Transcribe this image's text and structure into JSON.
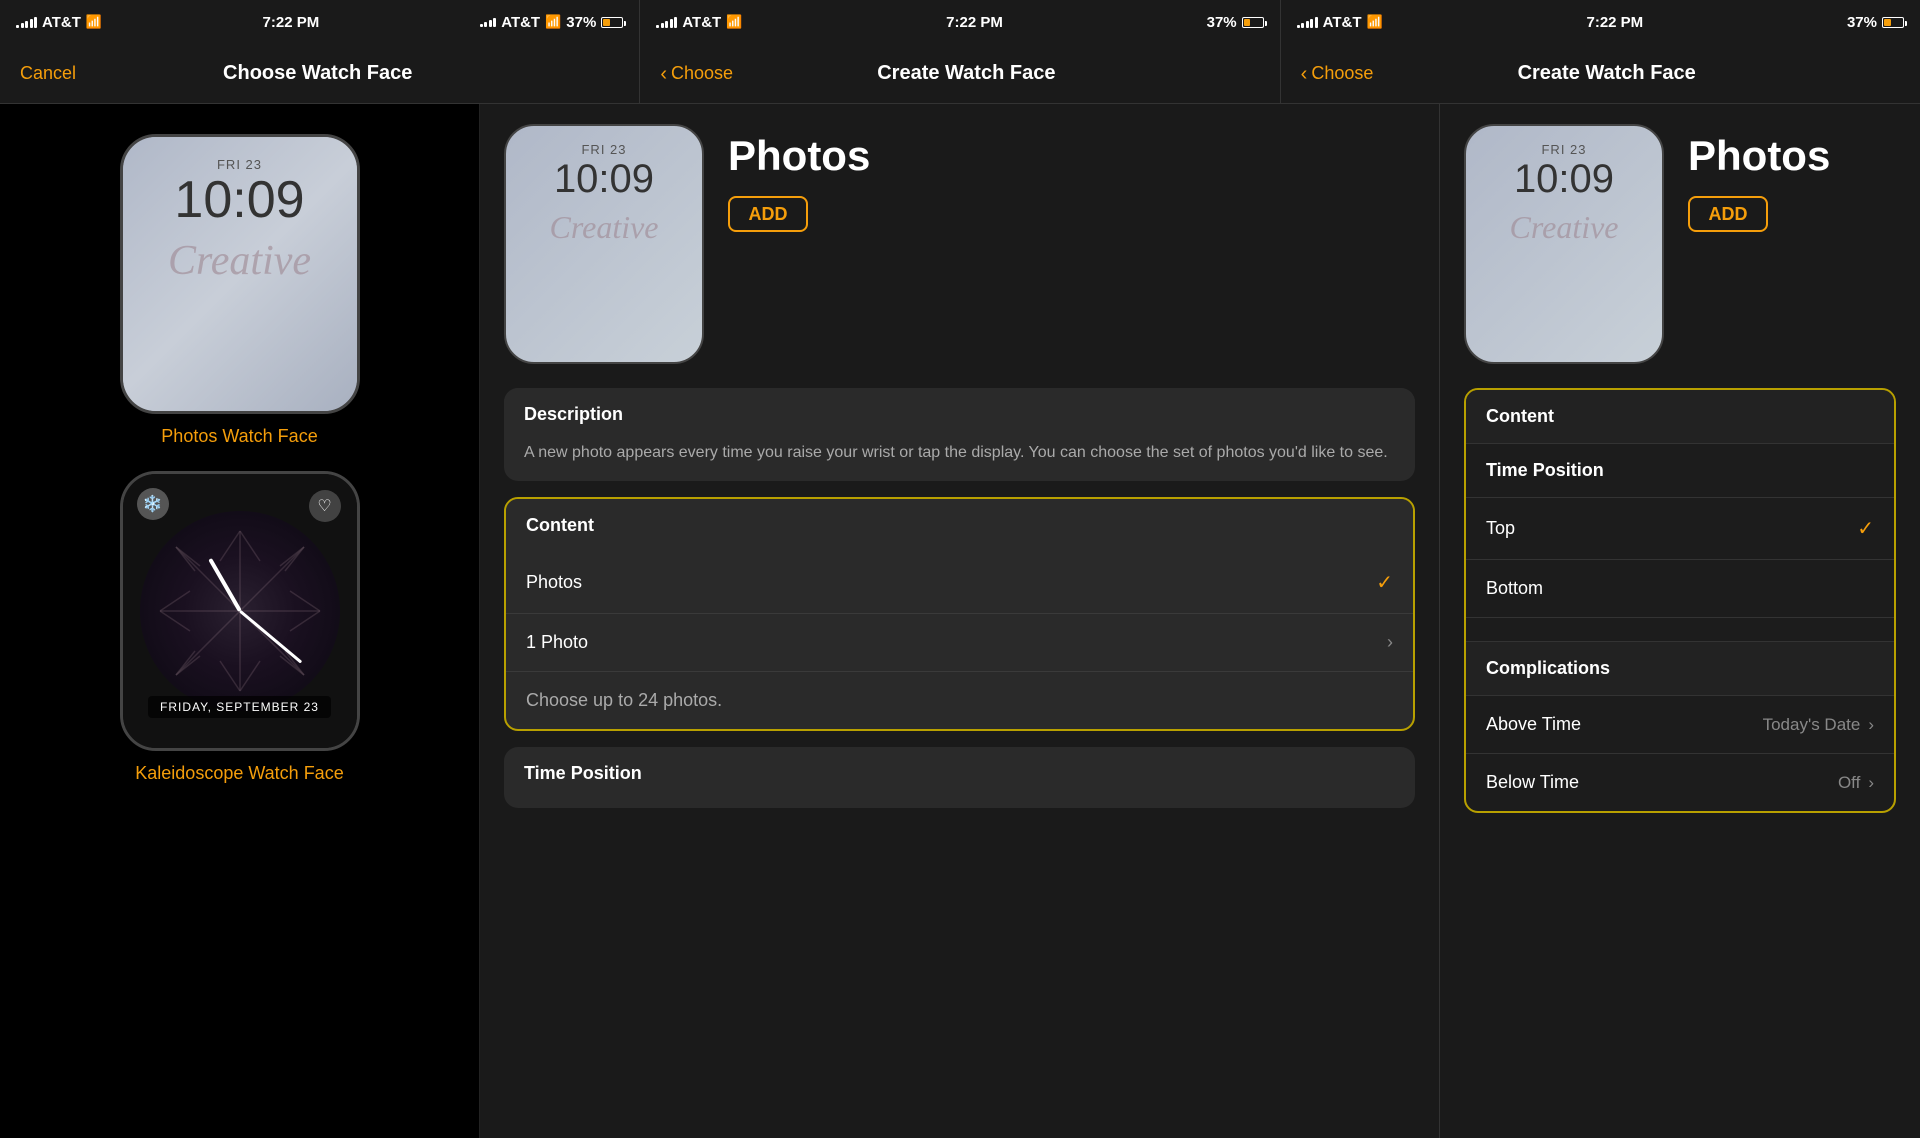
{
  "status": {
    "carrier": "AT&T",
    "time": "7:22 PM",
    "battery": "37%",
    "signal_bars": [
      3,
      5,
      7,
      9,
      11
    ]
  },
  "panels": {
    "panel1": {
      "nav": {
        "cancel_label": "Cancel",
        "title": "Choose Watch Face"
      },
      "watch_faces": [
        {
          "name": "photos-watch-face",
          "label": "Photos Watch Face",
          "date": "FRI 23",
          "time": "10:09",
          "script": "Creative"
        },
        {
          "name": "kaleidoscope-watch-face",
          "label": "Kaleidoscope Watch Face",
          "date": "FRIDAY, SEPTEMBER 23"
        }
      ]
    },
    "panel2": {
      "nav": {
        "back_label": "Choose",
        "title": "Create Watch Face"
      },
      "face_title": "Photos",
      "add_label": "ADD",
      "watch_preview": {
        "date": "FRI 23",
        "time": "10:09",
        "script": "Creative"
      },
      "description": {
        "header": "Description",
        "text": "A new photo appears every time you raise your wrist or tap the display. You can choose the set of photos you'd like to see."
      },
      "content_section": {
        "header": "Content",
        "rows": [
          {
            "label": "Photos",
            "value": "✓",
            "type": "check"
          },
          {
            "label": "1 Photo",
            "value": "›",
            "type": "chevron"
          },
          {
            "label": "Choose up to 24 photos.",
            "value": "",
            "type": "info"
          }
        ]
      },
      "time_position": {
        "header": "Time Position"
      }
    },
    "panel3": {
      "nav": {
        "back_label": "Choose",
        "title": "Create Watch Face"
      },
      "face_title": "Photos",
      "add_label": "ADD",
      "watch_preview": {
        "date": "FRI 23",
        "time": "10:09",
        "script": "Creative"
      },
      "dropdown": {
        "sections": [
          {
            "header": "Content",
            "rows": []
          },
          {
            "header": "Time Position",
            "rows": [
              {
                "label": "Top",
                "value": "✓",
                "type": "check"
              },
              {
                "label": "Bottom",
                "value": "",
                "type": "none"
              }
            ]
          },
          {
            "header": "Complications",
            "rows": [
              {
                "label": "Above Time",
                "value": "Today's Date",
                "type": "chevron"
              },
              {
                "label": "Below Time",
                "value": "Off",
                "type": "chevron"
              }
            ]
          }
        ]
      }
    }
  }
}
